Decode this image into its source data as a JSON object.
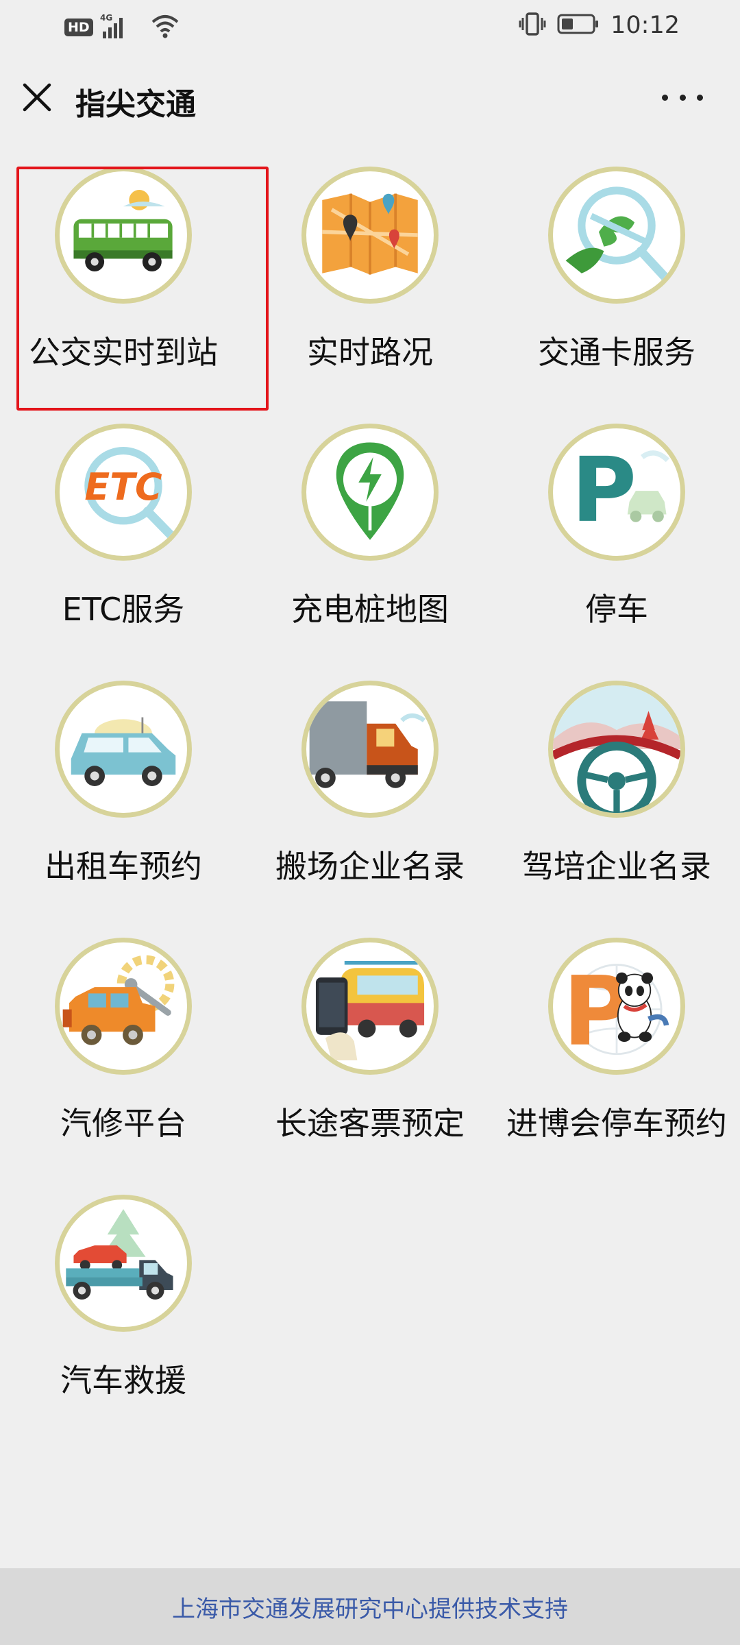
{
  "status_bar": {
    "network_badge": "HD",
    "network_type": "4G",
    "time": "10:12",
    "icons": [
      "signal-icon",
      "wifi-icon",
      "vibrate-icon",
      "battery-icon"
    ]
  },
  "header": {
    "title": "指尖交通",
    "close_icon": "close-icon",
    "more_icon": "more-icon"
  },
  "services": [
    {
      "label": "公交实时到站",
      "icon": "bus-icon",
      "selected": true
    },
    {
      "label": "实时路况",
      "icon": "map-icon"
    },
    {
      "label": "交通卡服务",
      "icon": "transit-card-icon"
    },
    {
      "label": "ETC服务",
      "icon": "etc-icon"
    },
    {
      "label": "充电桩地图",
      "icon": "charging-pile-icon"
    },
    {
      "label": "停车",
      "icon": "parking-icon"
    },
    {
      "label": "出租车预约",
      "icon": "taxi-icon"
    },
    {
      "label": "搬场企业名录",
      "icon": "moving-truck-icon"
    },
    {
      "label": "驾培企业名录",
      "icon": "steering-wheel-icon"
    },
    {
      "label": "汽修平台",
      "icon": "car-repair-icon"
    },
    {
      "label": "长途客票预定",
      "icon": "coach-ticket-icon"
    },
    {
      "label": "进博会停车预约",
      "icon": "expo-parking-icon"
    },
    {
      "label": "汽车救援",
      "icon": "tow-truck-icon"
    }
  ],
  "colors": {
    "highlight_border": "#e3141a",
    "icon_ring": "#d7d39a",
    "footer_text": "#3a5aa8"
  },
  "footer": {
    "text": "上海市交通发展研究中心提供技术支持"
  }
}
